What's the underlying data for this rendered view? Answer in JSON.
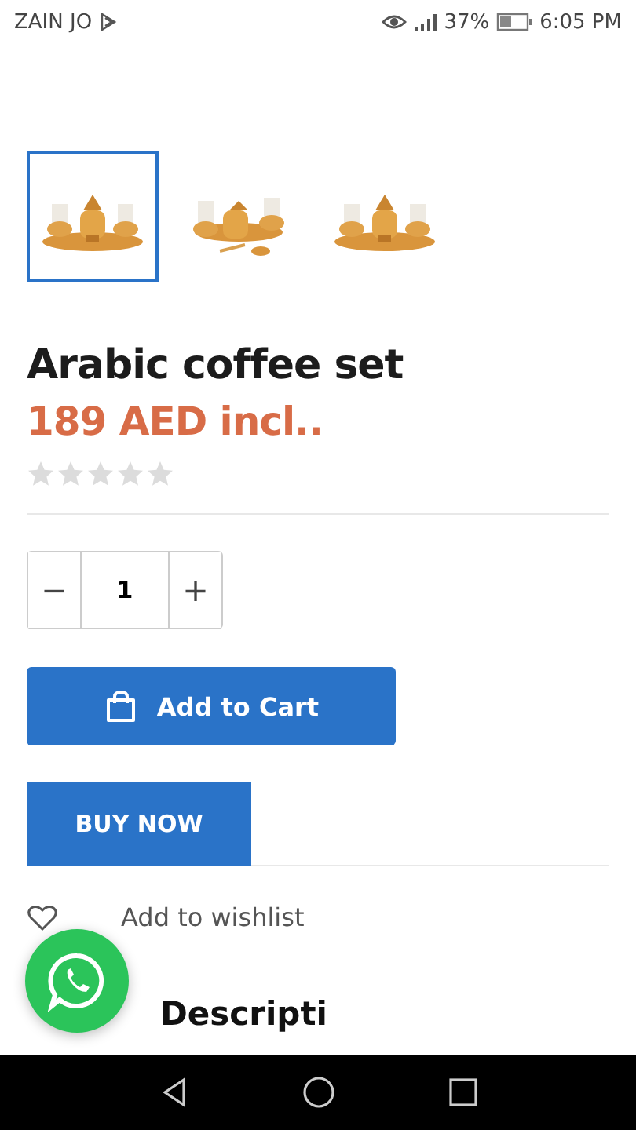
{
  "status_bar": {
    "carrier": "ZAIN JO",
    "battery": "37%",
    "time": "6:05 PM"
  },
  "gallery": [
    {
      "kind": "picture",
      "selected": true
    },
    {
      "kind": "picture",
      "selected": false
    },
    {
      "kind": "picture",
      "selected": false
    }
  ],
  "product": {
    "title": "Arabic coffee set",
    "price": "189 AED incl..",
    "stars": 0
  },
  "quantity": {
    "decrease": "−",
    "value": "1",
    "increase": "+"
  },
  "add_to_cart": "Add to Cart",
  "buy_now": "BUY NOW",
  "wishlist": "Add to wishlist",
  "section_heading": "Descripti"
}
